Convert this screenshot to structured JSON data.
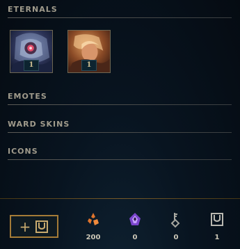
{
  "sections": {
    "eternals": "ETERNALS",
    "emotes": "EMOTES",
    "ward_skins": "WARD SKINS",
    "icons": "ICONS"
  },
  "eternals": [
    {
      "count": "1"
    },
    {
      "count": "1"
    }
  ],
  "footer": {
    "add_button": {
      "plus": "+",
      "icon": "chest-icon"
    },
    "currencies": [
      {
        "icon": "orange-essence-icon",
        "value": "200",
        "color": "#e0742c"
      },
      {
        "icon": "mythic-gem-icon",
        "value": "0",
        "color": "#9b63e6"
      },
      {
        "icon": "key-fragment-icon",
        "value": "0",
        "color": "#a7a7a0"
      },
      {
        "icon": "hextech-chest-icon",
        "value": "1",
        "color": "#b9b8b0"
      }
    ]
  },
  "colors": {
    "accent_gold": "#c8aa6e",
    "section_title": "#a09b8c",
    "background": "#050b12"
  }
}
